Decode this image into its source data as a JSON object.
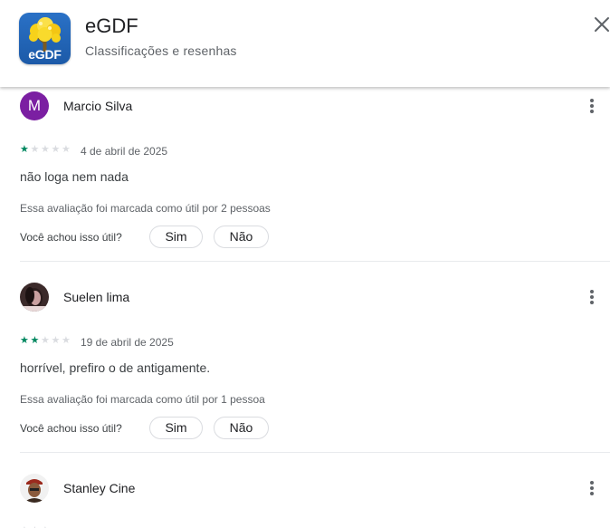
{
  "app": {
    "name": "eGDF",
    "icon_text": "eGDF",
    "subtitle": "Classificações e resenhas"
  },
  "reviews": [
    {
      "author": "Marcio Silva",
      "avatar_letter": "M",
      "rating": 1,
      "max_rating": 5,
      "date": "4 de abril de 2025",
      "text": "não loga nem nada",
      "helpful_count_text": "Essa avaliação foi marcada como útil por 2 pessoas",
      "helpful_question": "Você achou isso útil?",
      "yes_label": "Sim",
      "no_label": "Não"
    },
    {
      "author": "Suelen lima",
      "rating": 2,
      "max_rating": 5,
      "date": "19 de abril de 2025",
      "text": "horrível, prefiro o de antigamente.",
      "helpful_count_text": "Essa avaliação foi marcada como útil por 1 pessoa",
      "helpful_question": "Você achou isso útil?",
      "yes_label": "Sim",
      "no_label": "Não"
    },
    {
      "author": "Stanley Cine"
    }
  ],
  "colors": {
    "star_filled": "#01875f",
    "star_empty": "#dadce0",
    "avatar_letter_bg": "#7b1fa2",
    "app_icon_bg": "#1f62b5"
  },
  "icons": {
    "close": "close-icon",
    "more": "more-vert-icon",
    "star": "star-icon"
  }
}
